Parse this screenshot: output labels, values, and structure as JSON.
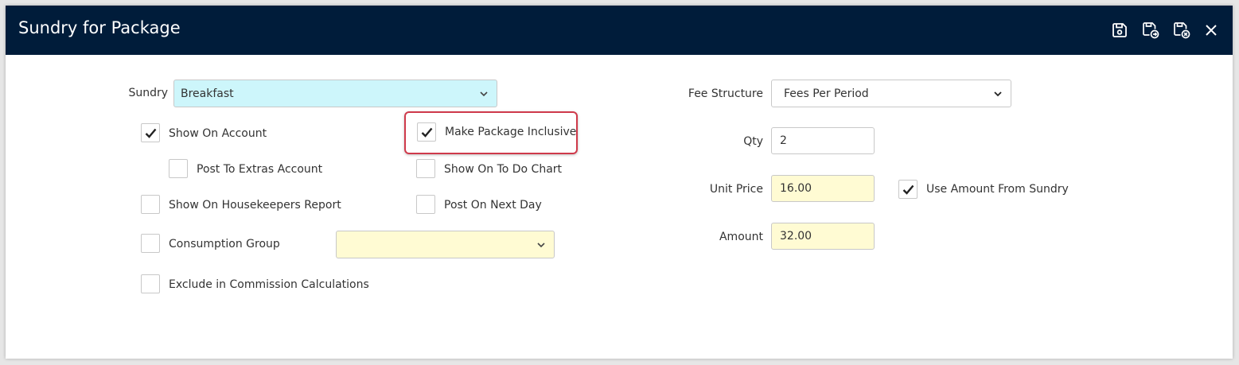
{
  "window": {
    "title": "Sundry for Package"
  },
  "toolbar": {
    "icons": [
      "save-icon",
      "save-and-copy-icon",
      "save-and-close-icon",
      "close-icon"
    ]
  },
  "form": {
    "sundry": {
      "label": "Sundry",
      "value": "Breakfast"
    },
    "show_on_account": {
      "label": "Show On Account",
      "checked": true
    },
    "make_package_inclusive": {
      "label": "Make Package Inclusive",
      "checked": true
    },
    "post_to_extras_account": {
      "label": "Post To Extras Account",
      "checked": false
    },
    "show_on_to_do_chart": {
      "label": "Show On To Do Chart",
      "checked": false
    },
    "show_on_housekeepers_report": {
      "label": "Show On Housekeepers Report",
      "checked": false
    },
    "post_on_next_day": {
      "label": "Post On Next Day",
      "checked": false
    },
    "consumption_group": {
      "label": "Consumption Group",
      "checked": false,
      "value": ""
    },
    "exclude_commission": {
      "label": "Exclude in Commission Calculations",
      "checked": false
    },
    "fee_structure": {
      "label": "Fee Structure",
      "value": "Fees Per Period"
    },
    "qty": {
      "label": "Qty",
      "value": "2"
    },
    "unit_price": {
      "label": "Unit Price",
      "value": "16.00"
    },
    "use_amount_from_sundry": {
      "label": "Use Amount From Sundry",
      "checked": true
    },
    "amount": {
      "label": "Amount",
      "value": "32.00"
    }
  },
  "colors": {
    "titlebar": "#001c3a",
    "highlight": "#cf3a4b",
    "readonly_field": "#fffbd3",
    "focused_field": "#cdf6fb"
  }
}
